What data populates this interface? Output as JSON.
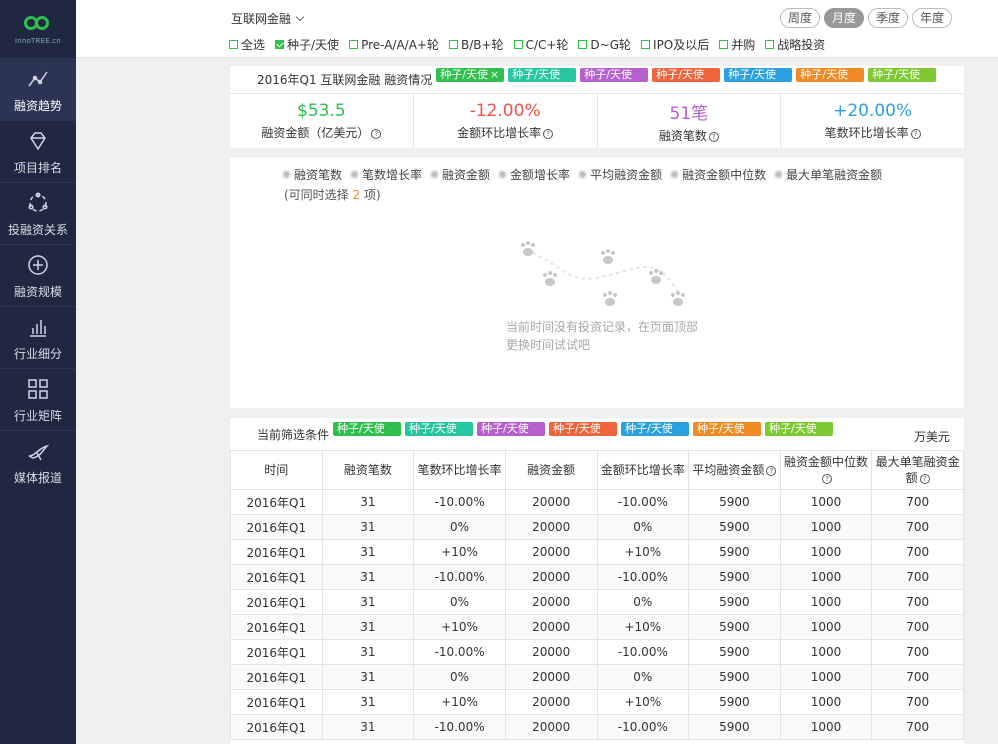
{
  "app": {
    "logo_text": "InnoTREE.cn"
  },
  "sidebar": {
    "items": [
      {
        "label": "融资趋势",
        "icon": "trend-line-icon",
        "active": true
      },
      {
        "label": "项目排名",
        "icon": "diamond-icon",
        "active": false
      },
      {
        "label": "投融资关系",
        "icon": "network-icon",
        "active": false
      },
      {
        "label": "融资规模",
        "icon": "plus-circle-icon",
        "active": false
      },
      {
        "label": "行业细分",
        "icon": "bar-chart-icon",
        "active": false
      },
      {
        "label": "行业矩阵",
        "icon": "matrix-icon",
        "active": false
      },
      {
        "label": "媒体报道",
        "icon": "bird-icon",
        "active": false
      }
    ]
  },
  "topbar": {
    "industry": "互联网金融",
    "rounds": [
      {
        "label": "全选",
        "checked": false
      },
      {
        "label": "种子/天使",
        "checked": true
      },
      {
        "label": "Pre-A/A/A+轮",
        "checked": false
      },
      {
        "label": "B/B+轮",
        "checked": false
      },
      {
        "label": "C/C+轮",
        "checked": false
      },
      {
        "label": "D~G轮",
        "checked": false
      },
      {
        "label": "IPO及以后",
        "checked": false
      },
      {
        "label": "并购",
        "checked": false
      },
      {
        "label": "战略投资",
        "checked": false
      }
    ],
    "periods": [
      {
        "label": "周度",
        "active": false
      },
      {
        "label": "月度",
        "active": true
      },
      {
        "label": "季度",
        "active": false
      },
      {
        "label": "年度",
        "active": false
      }
    ]
  },
  "summary": {
    "title": "2016年Q1 互联网金融 融资情况",
    "tags": [
      {
        "label": "种子/天使",
        "color": "#2fbf4d"
      },
      {
        "label": "种子/天使",
        "color": "#26c6a0"
      },
      {
        "label": "种子/天使",
        "color": "#b660d0"
      },
      {
        "label": "种子/天使",
        "color": "#f0643c"
      },
      {
        "label": "种子/天使",
        "color": "#2aa0e0"
      },
      {
        "label": "种子/天使",
        "color": "#f08a24"
      },
      {
        "label": "种子/天使",
        "color": "#7ec832"
      }
    ],
    "metrics": [
      {
        "value": "$53.5",
        "label": "融资金额（亿美元）",
        "color": "#2fbf4d"
      },
      {
        "value": "-12.00%",
        "label": "金额环比增长率",
        "color": "#f0524a"
      },
      {
        "value": "51笔",
        "label": "融资笔数",
        "color": "#b660d0"
      },
      {
        "value": "+20.00%",
        "label": "笔数环比增长率",
        "color": "#2aa0e0"
      }
    ]
  },
  "chart": {
    "options": [
      "融资笔数",
      "笔数增长率",
      "融资金额",
      "金额增长率",
      "平均融资金额",
      "融资金额中位数",
      "最大单笔融资金额"
    ],
    "hint_prefix": "(可同时选择 ",
    "hint_count": "2",
    "hint_suffix": " 项)",
    "empty_line1": "当前时间没有投资记录，在页面顶部",
    "empty_line2": "更换时间试试吧"
  },
  "table": {
    "filter_label": "当前筛选条件",
    "unit": "万美元",
    "tags": [
      {
        "label": "种子/天使",
        "color": "#2fbf4d"
      },
      {
        "label": "种子/天使",
        "color": "#26c6a0"
      },
      {
        "label": "种子/天使",
        "color": "#b660d0"
      },
      {
        "label": "种子/天使",
        "color": "#f0643c"
      },
      {
        "label": "种子/天使",
        "color": "#2aa0e0"
      },
      {
        "label": "种子/天使",
        "color": "#f08a24"
      },
      {
        "label": "种子/天使",
        "color": "#7ec832"
      }
    ],
    "columns": [
      "时间",
      "融资笔数",
      "笔数环比增长率",
      "融资金额",
      "金额环比增长率",
      "平均融资金额",
      "融资金额中位数",
      "最大单笔融资金额"
    ],
    "rows": [
      [
        "2016年Q1",
        "31",
        "-10.00%",
        "20000",
        "-10.00%",
        "5900",
        "1000",
        "700"
      ],
      [
        "2016年Q1",
        "31",
        "0%",
        "20000",
        "0%",
        "5900",
        "1000",
        "700"
      ],
      [
        "2016年Q1",
        "31",
        "+10%",
        "20000",
        "+10%",
        "5900",
        "1000",
        "700"
      ],
      [
        "2016年Q1",
        "31",
        "-10.00%",
        "20000",
        "-10.00%",
        "5900",
        "1000",
        "700"
      ],
      [
        "2016年Q1",
        "31",
        "0%",
        "20000",
        "0%",
        "5900",
        "1000",
        "700"
      ],
      [
        "2016年Q1",
        "31",
        "+10%",
        "20000",
        "+10%",
        "5900",
        "1000",
        "700"
      ],
      [
        "2016年Q1",
        "31",
        "-10.00%",
        "20000",
        "-10.00%",
        "5900",
        "1000",
        "700"
      ],
      [
        "2016年Q1",
        "31",
        "0%",
        "20000",
        "0%",
        "5900",
        "1000",
        "700"
      ],
      [
        "2016年Q1",
        "31",
        "+10%",
        "20000",
        "+10%",
        "5900",
        "1000",
        "700"
      ],
      [
        "2016年Q1",
        "31",
        "-10.00%",
        "20000",
        "-10.00%",
        "5900",
        "1000",
        "700"
      ]
    ]
  }
}
